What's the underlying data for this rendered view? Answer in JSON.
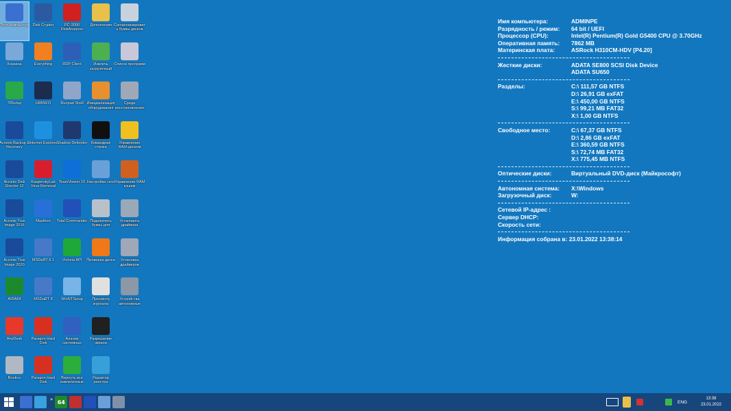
{
  "desktop_icons": [
    {
      "label": "Этот компьютер",
      "icon": "computer-icon",
      "color": "#3b6fd0"
    },
    {
      "label": "Disk Cryptor",
      "icon": "disk-cryptor-icon",
      "color": "#2c5aa0"
    },
    {
      "label": "PC-3000 DiskAnalyzer",
      "icon": "pc3000-icon",
      "color": "#d02020"
    },
    {
      "label": "Дополнения",
      "icon": "folder-icon",
      "color": "#e8c04a"
    },
    {
      "label": "Синхронизировать буквы дисков",
      "icon": "sync-drive-icon",
      "color": "#c8d2dc"
    },
    {
      "label": "Корзина",
      "icon": "recycle-bin-icon",
      "color": "#7aa8d8"
    },
    {
      "label": "Everything",
      "icon": "magnifier-icon",
      "color": "#f08020"
    },
    {
      "label": "RDP Client",
      "icon": "rdp-icon",
      "color": "#2d5fb8"
    },
    {
      "label": "Извлечь загрузочный",
      "icon": "extract-icon",
      "color": "#4caf50"
    },
    {
      "label": "Список программ",
      "icon": "programs-list-icon",
      "color": "#c8c8d8"
    },
    {
      "label": "78Setup",
      "icon": "setup-icon",
      "color": "#2aa84a"
    },
    {
      "label": "HWiNFO",
      "icon": "hwinfo-icon",
      "color": "#1b2c4c"
    },
    {
      "label": "Runpad Shell",
      "icon": "runpad-icon",
      "color": "#8fa6c9"
    },
    {
      "label": "Инициализация оборудования",
      "icon": "init-hardware-icon",
      "color": "#e89030"
    },
    {
      "label": "Среда восстановления",
      "icon": "recovery-icon",
      "color": "#a0a8b8"
    },
    {
      "label": "Acronis Backup & Recovery",
      "icon": "acronis-backup-icon",
      "color": "#1a4a9a"
    },
    {
      "label": "Internet Explorer",
      "icon": "ie-icon",
      "color": "#1e90e0"
    },
    {
      "label": "Shadow Defender",
      "icon": "shadow-defender-icon",
      "color": "#203870"
    },
    {
      "label": "Командная строка",
      "icon": "cmd-icon",
      "color": "#101010"
    },
    {
      "label": "Управление RAM-диском",
      "icon": "ram-disk-icon",
      "color": "#f0c020"
    },
    {
      "label": "Acronis Disk Director 12",
      "icon": "acronis-dd-icon",
      "color": "#1a4a9a"
    },
    {
      "label": "KasperskyLab Virus Removal",
      "icon": "kaspersky-icon",
      "color": "#d81e2e"
    },
    {
      "label": "TeamViewer 15",
      "icon": "teamviewer-icon",
      "color": "#0e6fd8"
    },
    {
      "label": "Настройка сети",
      "icon": "network-icon",
      "color": "#6aa0d8"
    },
    {
      "label": "Управление RAM кэшем",
      "icon": "ram-cache-icon",
      "color": "#d06020"
    },
    {
      "label": "Acronis True Image 2016",
      "icon": "acronis-ti-icon",
      "color": "#1a4a9a"
    },
    {
      "label": "Maxthon",
      "icon": "maxthon-icon",
      "color": "#2870d8"
    },
    {
      "label": "Total Commander",
      "icon": "total-commander-icon",
      "color": "#2050b8"
    },
    {
      "label": "Подключить буквы для",
      "icon": "mount-drive-icon",
      "color": "#b8c0cc"
    },
    {
      "label": "Установить драйвера",
      "icon": "install-driver-icon",
      "color": "#9aa8b8"
    },
    {
      "label": "Acronis True Image 2020",
      "icon": "acronis-ti-icon",
      "color": "#1a4a9a"
    },
    {
      "label": "MSDaRT 8.1",
      "icon": "msdart-icon",
      "color": "#4878c8"
    },
    {
      "label": "Victoria API",
      "icon": "victoria-icon",
      "color": "#1ea83a"
    },
    {
      "label": "Проверка диска",
      "icon": "checkmark-icon",
      "color": "#f07818"
    },
    {
      "label": "Установка драйверов",
      "icon": "driver-setup-icon",
      "color": "#a0a8b8"
    },
    {
      "label": "AIDA64",
      "icon": "aida64-icon",
      "color": "#1c8a2c"
    },
    {
      "label": "MSDaRT 8",
      "icon": "msdart-icon",
      "color": "#4878c8"
    },
    {
      "label": "WinNTSetup",
      "icon": "winntsetup-icon",
      "color": "#78b4e8"
    },
    {
      "label": "Просмотр журнала",
      "icon": "log-viewer-icon",
      "color": "#e0e0e0"
    },
    {
      "label": "Устройства автономные",
      "icon": "devices-icon",
      "color": "#8a98a8"
    },
    {
      "label": "AnyDesk",
      "icon": "anydesk-icon",
      "color": "#e8382a"
    },
    {
      "label": "Paragon Hard Disk",
      "icon": "paragon-icon",
      "color": "#d83020"
    },
    {
      "label": "Анализ системных",
      "icon": "system-analysis-icon",
      "color": "#3060c0"
    },
    {
      "label": "Разрешение экрана",
      "icon": "screen-resolution-icon",
      "color": "#202020"
    },
    null,
    {
      "label": "Bootice",
      "icon": "bootice-icon",
      "color": "#b0b8c4"
    },
    {
      "label": "Paragon Hard Disk",
      "icon": "paragon-icon",
      "color": "#d83020"
    },
    {
      "label": "Вернуть все извлеченные",
      "icon": "return-arrow-icon",
      "color": "#2cae3c"
    },
    {
      "label": "Редактор реестра",
      "icon": "registry-editor-icon",
      "color": "#38a0d8"
    }
  ],
  "sysinfo": {
    "computer_name": {
      "label": "Имя компьютера:",
      "value": "ADMINPE"
    },
    "arch": {
      "label": "Разрядность / режим:",
      "value": "64 bit / UEFI"
    },
    "cpu": {
      "label": "Процессор (CPU):",
      "value": "Intel(R) Pentium(R) Gold G5400 CPU @ 3.70GHz"
    },
    "ram": {
      "label": "Оперативная память:",
      "value": "7862 MB"
    },
    "board": {
      "label": "Материнская плата:",
      "value": "ASRock H310CM-HDV [P4.20]"
    },
    "disks": {
      "label": "Жесткие диски:",
      "values": [
        "ADATA SE800 SCSI Disk Device",
        "ADATA SU650"
      ]
    },
    "partitions": {
      "label": "Разделы:",
      "values": [
        "C:\\ 111,57 GB NTFS",
        "D:\\ 26,91 GB exFAT",
        "E:\\ 450,00 GB NTFS",
        "S:\\ 99,21 MB FAT32",
        "X:\\ 1,00 GB NTFS"
      ]
    },
    "free": {
      "label": "Свободное место:",
      "values": [
        "C:\\ 67,37 GB NTFS",
        "D:\\ 2,86 GB exFAT",
        "E:\\ 360,59 GB NTFS",
        "S:\\ 72,74 MB FAT32",
        "X:\\ 775,45 MB NTFS"
      ]
    },
    "optical": {
      "label": "Оптические диски:",
      "value": "Виртуальный DVD-диск (Майкрософт)"
    },
    "standalone": {
      "label": "Автономная система:",
      "value": "X:\\Windows"
    },
    "boot_disk": {
      "label": "Загрузочный диск:",
      "value": "W:"
    },
    "ip": {
      "label": "Сетевой IP-адрес :",
      "value": ""
    },
    "dhcp": {
      "label": "Сервер DHCP:",
      "value": ""
    },
    "speed": {
      "label": "Скорость сети:",
      "value": ""
    },
    "collected": "Информация собрана в: 23.01.2022 13:38:14"
  },
  "taskbar": {
    "start_icon": "windows-start-icon",
    "pinned": [
      {
        "icon": "explorer-icon",
        "color": "#3b6fd0",
        "text": ""
      },
      {
        "icon": "pen-tool-icon",
        "color": "#3aa0e0",
        "text": ""
      },
      {
        "icon": "aida64-icon",
        "color": "#1c8a2c",
        "text": "64"
      },
      {
        "icon": "hdd-tool-icon",
        "color": "#c03030",
        "text": ""
      },
      {
        "icon": "save-icon",
        "color": "#2050b8",
        "text": ""
      },
      {
        "icon": "network-icon",
        "color": "#6aa0d8",
        "text": ""
      },
      {
        "icon": "window-icon",
        "color": "#8090a8",
        "text": ""
      }
    ],
    "overflow": "»",
    "lang": "ENG",
    "time": "13:38",
    "date": "23.01.2022"
  }
}
